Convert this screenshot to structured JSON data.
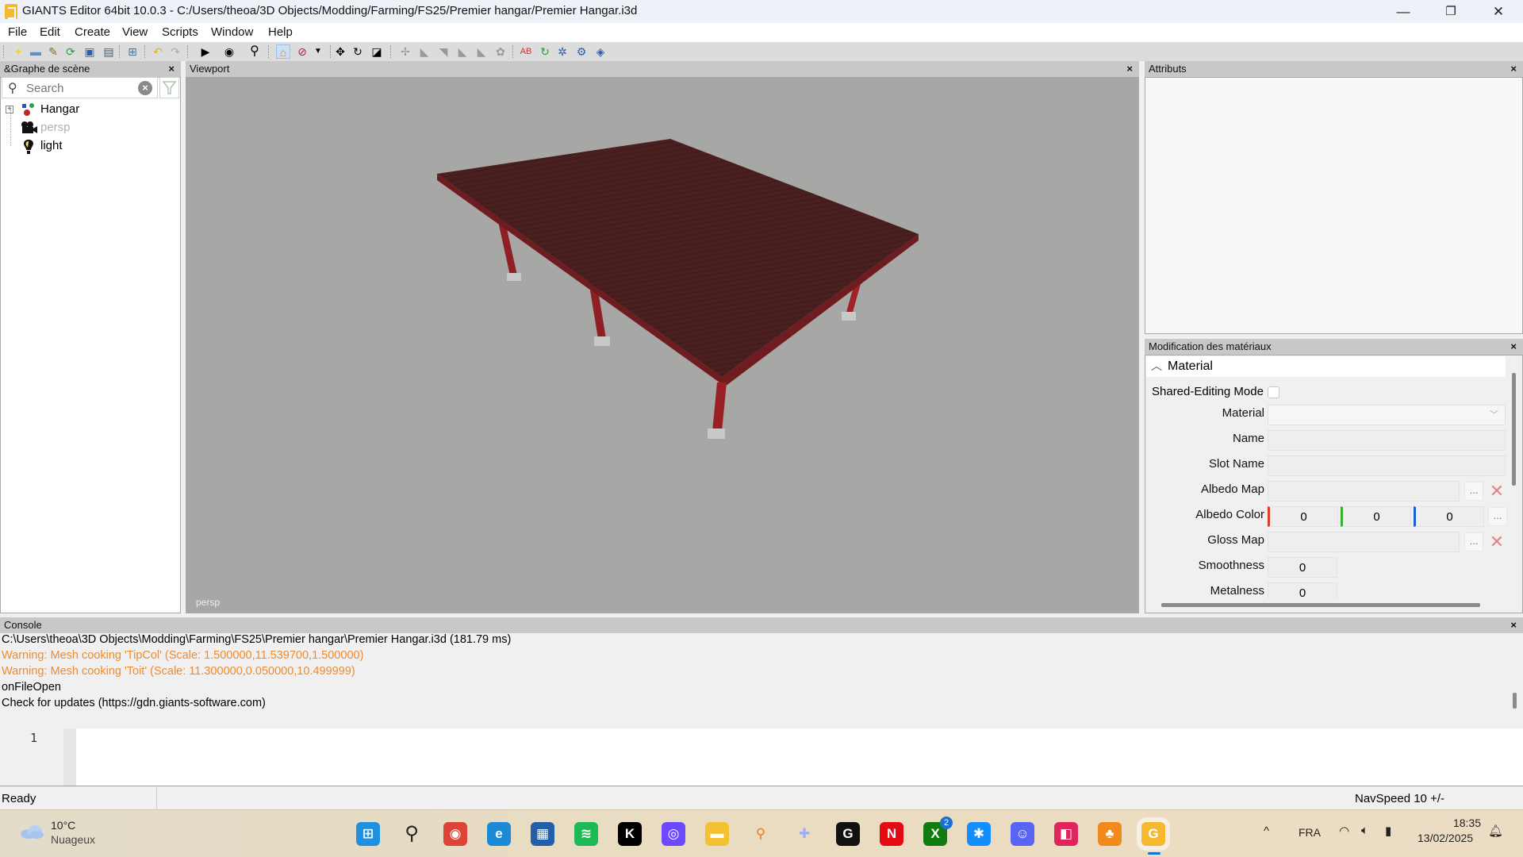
{
  "window": {
    "title": "GIANTS Editor 64bit 10.0.3 - C:/Users/theoa/3D Objects/Modding/Farming/FS25/Premier hangar/Premier Hangar.i3d",
    "controls": {
      "minimize": "—",
      "maximize": "❐",
      "close": "✕"
    }
  },
  "menu": [
    "File",
    "Edit",
    "Create",
    "View",
    "Scripts",
    "Window",
    "Help"
  ],
  "toolbar": {
    "groups": [
      [
        "new-file-icon",
        "open-folder-icon",
        "edit-icon",
        "reload-icon",
        "save-icon",
        "save-all-icon"
      ],
      [
        "import-icon"
      ],
      [
        "undo-icon",
        "redo-icon"
      ],
      [
        "play-icon",
        "eye-icon",
        "search-icon"
      ],
      [
        "home-camera-icon",
        "no-select-icon",
        "dropdown-arrow-icon"
      ],
      [
        "move-icon",
        "rotate-icon",
        "scale-icon"
      ],
      [
        "terrain-tool-1-icon",
        "terrain-tool-2-icon",
        "terrain-tool-3-icon",
        "terrain-tool-4-icon",
        "terrain-tool-5-icon",
        "foliage-tool-icon"
      ],
      [
        "ab-icon",
        "refresh-icon",
        "sync-icon",
        "settings-icon",
        "export-icon"
      ]
    ]
  },
  "scene_graph": {
    "title": "&Graphe de scène",
    "close": "×",
    "search_placeholder": "Search",
    "items": [
      {
        "label": "Hangar",
        "icon": "transform-group-icon",
        "expandable": true,
        "dimmed": false
      },
      {
        "label": "persp",
        "icon": "camera-icon",
        "expandable": false,
        "dimmed": true
      },
      {
        "label": "light",
        "icon": "light-bulb-icon",
        "expandable": false,
        "dimmed": false
      }
    ]
  },
  "viewport": {
    "title": "Viewport",
    "close": "×",
    "camera_label": "persp",
    "background": "#a7a7a5",
    "roof_color": "#4a1f20",
    "pillar_color": "#8f1f24"
  },
  "attributes": {
    "title": "Attributs",
    "close": "×"
  },
  "material_editor": {
    "title": "Modification des matériaux",
    "close": "×",
    "section": "Material",
    "shared_editing_label": "Shared-Editing Mode",
    "shared_editing_checked": false,
    "fields": {
      "material": {
        "label": "Material",
        "value": ""
      },
      "name": {
        "label": "Name",
        "value": ""
      },
      "slot_name": {
        "label": "Slot Name",
        "value": ""
      },
      "albedo_map": {
        "label": "Albedo Map",
        "value": ""
      },
      "albedo_color": {
        "label": "Albedo Color",
        "r": "0",
        "g": "0",
        "b": "0"
      },
      "gloss_map": {
        "label": "Gloss Map",
        "value": ""
      },
      "smoothness": {
        "label": "Smoothness",
        "value": "0"
      },
      "metalness": {
        "label": "Metalness",
        "value": "0"
      }
    },
    "browse_label": "...",
    "clear_label": "✕"
  },
  "console": {
    "title": "Console",
    "close": "×",
    "lines": [
      {
        "text": "C:\\Users\\theoa\\3D Objects\\Modding\\Farming\\FS25\\Premier hangar\\Premier Hangar.i3d (181.79 ms)",
        "type": "info"
      },
      {
        "text": "Warning: Mesh cooking 'TipCol' (Scale: 1.500000,11.539700,1.500000)",
        "type": "warning"
      },
      {
        "text": "Warning: Mesh cooking 'Toit' (Scale: 11.300000,0.050000,10.499999)",
        "type": "warning"
      },
      {
        "text": "onFileOpen",
        "type": "info"
      },
      {
        "text": "Check for updates (https://gdn.giants-software.com)",
        "type": "info"
      }
    ],
    "editor_line_number": "1",
    "editor_value": ""
  },
  "status_bar": {
    "left": "Ready",
    "right": "NavSpeed 10 +/-"
  },
  "taskbar": {
    "weather": {
      "temp": "10°C",
      "desc": "Nuageux"
    },
    "apps": [
      {
        "name": "start",
        "glyph": "⊞",
        "color": "#1e90e0"
      },
      {
        "name": "search",
        "glyph": "⚲",
        "color": "#222"
      },
      {
        "name": "chrome",
        "glyph": "◉",
        "color": "#db4437"
      },
      {
        "name": "edge",
        "glyph": "e",
        "color": "#1c8ad6"
      },
      {
        "name": "microsoft-store",
        "glyph": "▦",
        "color": "#235ea8"
      },
      {
        "name": "spotify",
        "glyph": "≋",
        "color": "#1db954"
      },
      {
        "name": "k-app",
        "glyph": "K",
        "color": "#000000"
      },
      {
        "name": "proton-app",
        "glyph": "◎",
        "color": "#6d4aff"
      },
      {
        "name": "file-explorer",
        "glyph": "▬",
        "color": "#f2c230"
      },
      {
        "name": "magnifier",
        "glyph": "⚲",
        "color": "#f07a1a"
      },
      {
        "name": "game-controller",
        "glyph": "✚",
        "color": "#9ab0f0"
      },
      {
        "name": "logitech-g",
        "glyph": "G",
        "color": "#111111"
      },
      {
        "name": "netflix",
        "glyph": "N",
        "color": "#e50914"
      },
      {
        "name": "xbox",
        "glyph": "X",
        "color": "#107c10",
        "badge": "2"
      },
      {
        "name": "battle-net",
        "glyph": "✱",
        "color": "#148eff"
      },
      {
        "name": "discord",
        "glyph": "☺",
        "color": "#5865f2"
      },
      {
        "name": "app-red",
        "glyph": "◧",
        "color": "#e0245e"
      },
      {
        "name": "fl-studio",
        "glyph": "♣",
        "color": "#f08a1c"
      },
      {
        "name": "giants-editor",
        "glyph": "G",
        "color": "#f5b82e",
        "active": true
      }
    ],
    "tray": {
      "chevron": "^",
      "language": "FRA",
      "time": "18:35",
      "date": "13/02/2025"
    }
  }
}
